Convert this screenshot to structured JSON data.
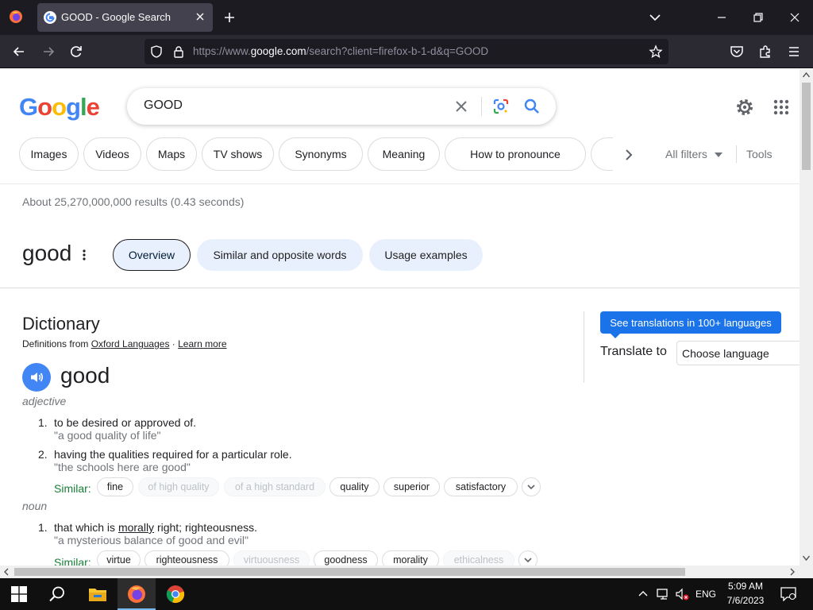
{
  "browser": {
    "tab_title": "GOOD - Google Search",
    "url_prefix": "https://www.",
    "url_host": "google.com",
    "url_path": "/search?client=firefox-b-1-d&q=GOOD"
  },
  "search": {
    "logo": [
      "G",
      "o",
      "o",
      "g",
      "l",
      "e"
    ],
    "logo_colors": [
      "#4285f4",
      "#ea4335",
      "#fbbc05",
      "#4285f4",
      "#34a853",
      "#ea4335"
    ],
    "query": "GOOD"
  },
  "chips": [
    "Images",
    "Videos",
    "Maps",
    "TV shows",
    "Synonyms",
    "Meaning",
    "How to pronounce"
  ],
  "filters": {
    "all_filters": "All filters",
    "tools": "Tools"
  },
  "result_stats": "About 25,270,000,000 results (0.43 seconds)",
  "knowledge_panel": {
    "word": "good",
    "tabs": [
      "Overview",
      "Similar and opposite words",
      "Usage examples"
    ]
  },
  "dictionary": {
    "title": "Dictionary",
    "source_prefix": "Definitions from ",
    "source_link": "Oxford Languages",
    "source_sep": " · ",
    "learn_more": "Learn more",
    "headword": "good",
    "adjective": {
      "pos": "adjective",
      "defs": [
        {
          "num": "1.",
          "text": "to be desired or approved of.",
          "example": "\"a good quality of life\""
        },
        {
          "num": "2.",
          "text": "having the qualities required for a particular role.",
          "example": "\"the schools here are good\""
        }
      ],
      "similar_label": "Similar:",
      "similar": [
        "fine",
        "of high quality",
        "of a high standard",
        "quality",
        "superior",
        "satisfactory"
      ]
    },
    "noun": {
      "pos": "noun",
      "defs": [
        {
          "num": "1.",
          "text_before": "that which is ",
          "text_link": "morally",
          "text_after": " right; righteousness.",
          "example": "\"a mysterious balance of good and evil\""
        }
      ],
      "similar_label": "Similar:",
      "similar": [
        "virtue",
        "righteousness",
        "virtuousness",
        "goodness",
        "morality",
        "ethicalness"
      ]
    }
  },
  "translate": {
    "tooltip": "See translations in 100+ languages",
    "label": "Translate to",
    "select_value": "Choose language"
  },
  "taskbar": {
    "lang": "ENG",
    "time": "5:09 AM",
    "date": "7/6/2023"
  }
}
